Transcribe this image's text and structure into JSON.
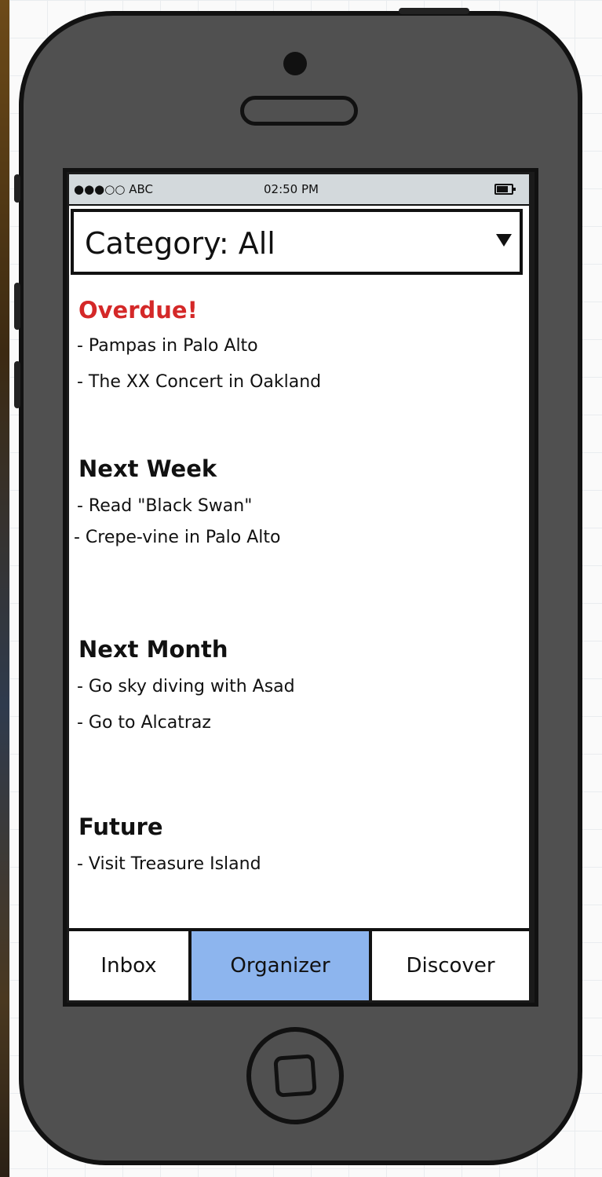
{
  "status_bar": {
    "carrier": "●●●○○ ABC",
    "time": "02:50 PM",
    "battery_icon": "battery-icon"
  },
  "category_picker": {
    "label": "Category: All",
    "arrow_icon": "dropdown-arrow-icon"
  },
  "sections": [
    {
      "title": "Overdue!",
      "items": [
        "- Pampas in Palo Alto",
        "- The XX Concert in Oakland"
      ]
    },
    {
      "title": "Next Week",
      "items": [
        "- Read \"Black Swan\"",
        "- Crepe-vine in Palo Alto"
      ]
    },
    {
      "title": "Next Month",
      "items": [
        "- Go sky diving with Asad",
        "- Go to Alcatraz"
      ]
    },
    {
      "title": "Future",
      "items": [
        "- Visit Treasure Island"
      ]
    }
  ],
  "tabs": [
    {
      "label": "Inbox",
      "active": false
    },
    {
      "label": "Organizer",
      "active": true
    },
    {
      "label": "Discover",
      "active": false
    }
  ],
  "colors": {
    "overdue": "#d42828",
    "active_tab": "#8db5ee",
    "phone_body": "#505050",
    "status_bar": "#d3d9dc"
  }
}
